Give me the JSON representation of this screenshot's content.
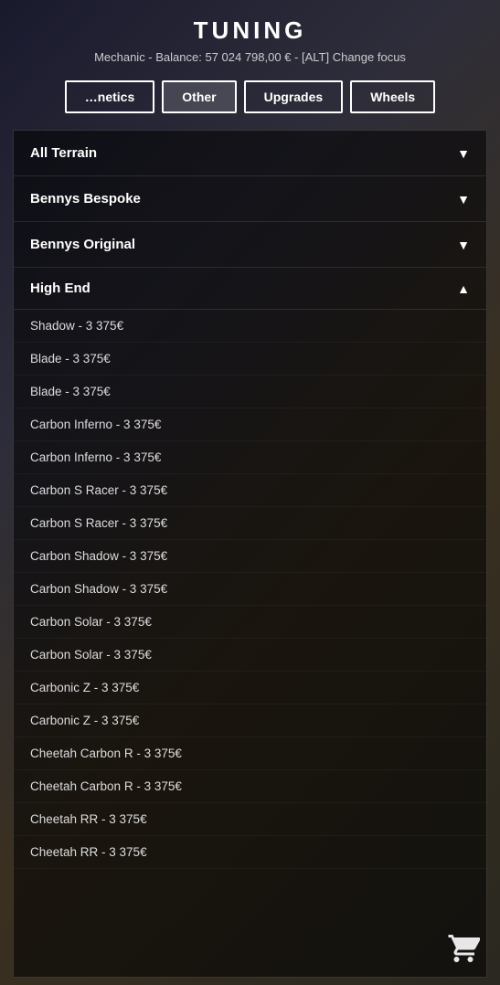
{
  "header": {
    "title": "TUNING",
    "subtitle": "Mechanic - Balance: 57 024 798,00 € - [ALT] Change focus"
  },
  "tabs": [
    {
      "id": "cosmetics",
      "label": "…netics",
      "active": false
    },
    {
      "id": "other",
      "label": "Other",
      "active": true
    },
    {
      "id": "upgrades",
      "label": "Upgrades",
      "active": false
    },
    {
      "id": "wheels",
      "label": "Wheels",
      "active": false
    }
  ],
  "sections": [
    {
      "id": "all-terrain",
      "label": "All Terrain",
      "expanded": false,
      "arrow": "▼"
    },
    {
      "id": "bennys-bespoke",
      "label": "Bennys Bespoke",
      "expanded": false,
      "arrow": "▼"
    },
    {
      "id": "bennys-original",
      "label": "Bennys Original",
      "expanded": false,
      "arrow": "▼"
    },
    {
      "id": "high-end",
      "label": "High End",
      "expanded": true,
      "arrow": "▲",
      "items": [
        "Shadow - 3 375€",
        "Blade - 3 375€",
        "Blade - 3 375€",
        "Carbon Inferno - 3 375€",
        "Carbon Inferno - 3 375€",
        "Carbon S Racer - 3 375€",
        "Carbon S Racer - 3 375€",
        "Carbon Shadow - 3 375€",
        "Carbon Shadow - 3 375€",
        "Carbon Solar - 3 375€",
        "Carbon Solar - 3 375€",
        "Carbonic Z - 3 375€",
        "Carbonic Z - 3 375€",
        "Cheetah Carbon R - 3 375€",
        "Cheetah Carbon R - 3 375€",
        "Cheetah RR - 3 375€",
        "Cheetah RR - 3 375€"
      ]
    }
  ],
  "cart": {
    "icon_label": "cart-icon"
  }
}
